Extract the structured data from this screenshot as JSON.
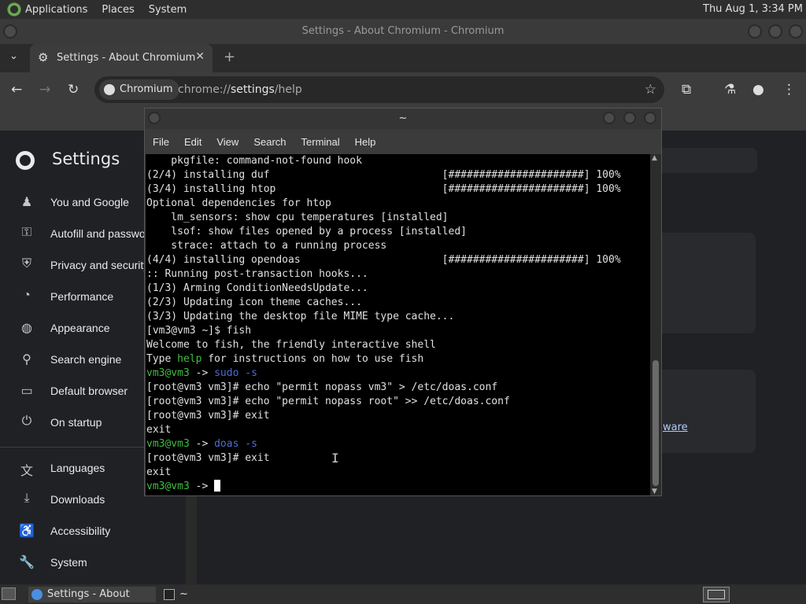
{
  "top_panel": {
    "menus": [
      "Applications",
      "Places",
      "System"
    ],
    "clock": "Thu Aug  1,  3:34 PM"
  },
  "chromium": {
    "window_title": "Settings - About Chromium - Chromium",
    "tab_title": "Settings - About Chromium",
    "omnibox": {
      "chip": "Chromium",
      "url_prefix": "chrome://",
      "url_host": "settings",
      "url_path": "/help"
    }
  },
  "settings": {
    "title": "Settings",
    "nav": [
      {
        "label": "You and Google",
        "icon": "person-icon"
      },
      {
        "label": "Autofill and passwords",
        "icon": "key-icon"
      },
      {
        "label": "Privacy and security",
        "icon": "shield-icon"
      },
      {
        "label": "Performance",
        "icon": "speedometer-icon"
      },
      {
        "label": "Appearance",
        "icon": "palette-icon"
      },
      {
        "label": "Search engine",
        "icon": "search-icon"
      },
      {
        "label": "Default browser",
        "icon": "browser-icon"
      },
      {
        "label": "On startup",
        "icon": "power-icon"
      },
      {
        "label": "Languages",
        "icon": "translate-icon"
      },
      {
        "label": "Downloads",
        "icon": "download-icon"
      },
      {
        "label": "Accessibility",
        "icon": "accessibility-icon"
      },
      {
        "label": "System",
        "icon": "wrench-icon"
      }
    ],
    "background_link": "ware",
    "background_link_suffix": "."
  },
  "terminal": {
    "title": "~",
    "menus": [
      "File",
      "Edit",
      "View",
      "Search",
      "Terminal",
      "Help"
    ],
    "lines": [
      "    pkgfile: command-not-found hook",
      "(2/4) installing duf                            [######################] 100%",
      "(3/4) installing htop                           [######################] 100%",
      "Optional dependencies for htop",
      "    lm_sensors: show cpu temperatures [installed]",
      "    lsof: show files opened by a process [installed]",
      "    strace: attach to a running process",
      "(4/4) installing opendoas                       [######################] 100%",
      ":: Running post-transaction hooks...",
      "(1/3) Arming ConditionNeedsUpdate...",
      "(2/3) Updating icon theme caches...",
      "(3/3) Updating the desktop file MIME type cache...",
      "[vm3@vm3 ~]$ fish",
      "Welcome to fish, the friendly interactive shell",
      "Type help for instructions on how to use fish",
      "vm3@vm3 -> sudo -s",
      "[root@vm3 vm3]# echo \"permit nopass vm3\" > /etc/doas.conf",
      "[root@vm3 vm3]# echo \"permit nopass root\" >> /etc/doas.conf",
      "[root@vm3 vm3]# exit",
      "exit",
      "vm3@vm3 -> doas -s",
      "[root@vm3 vm3]# exit",
      "exit",
      "vm3@vm3 -> "
    ],
    "fish_help_word": "help",
    "prompt_user": "vm3@vm3",
    "prompt_arrow": " -> ",
    "cmd_sudo": "sudo -s",
    "cmd_doas": "doas -s"
  },
  "taskbar": {
    "tasks": [
      "Settings - About Ch...",
      "~"
    ]
  },
  "colors": {
    "prompt_green": "#3fbf3f",
    "cmd_blue": "#4a6fd8",
    "terminal_bg": "#000000",
    "settings_bg": "#202124"
  }
}
